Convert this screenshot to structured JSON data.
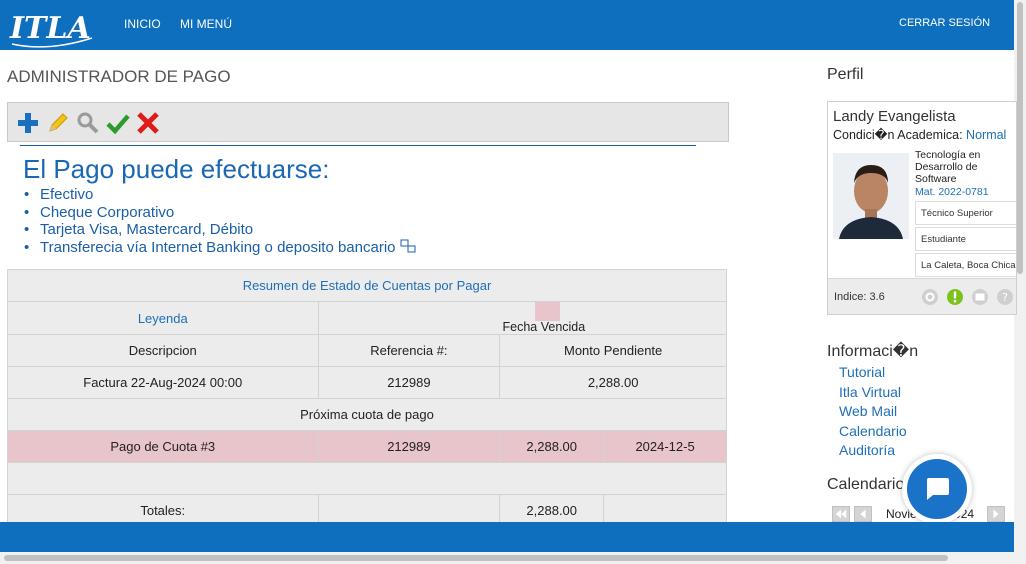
{
  "header": {
    "logo_text": "ITLA",
    "nav": [
      "INICIO",
      "MI MENÚ"
    ],
    "logout": "CERRAR SESIÓN"
  },
  "main": {
    "page_title": "ADMINISTRADOR DE PAGO",
    "toolbar_icons": [
      "add-icon",
      "edit-icon",
      "search-icon",
      "approve-icon",
      "delete-icon"
    ],
    "payment_heading": "El Pago puede efectuarse:",
    "payment_methods": [
      "Efectivo",
      "Cheque Corporativo",
      "Tarjeta Visa, Mastercard, Débito",
      "Transferecia vía Internet Banking o deposito bancario"
    ],
    "summary": {
      "caption": "Resumen de Estado de Cuentas por Pagar",
      "legend_label": "Leyenda",
      "legend_overdue": "Fecha Vencida",
      "columns": [
        "Descripcion",
        "Referencia #:",
        "Monto Pendiente"
      ],
      "invoice": {
        "description": "Factura 22-Aug-2024 00:00",
        "reference": "212989",
        "amount": "2,288.00"
      },
      "next_installment_label": "Próxima cuota de pago",
      "installment": {
        "description": "Pago de Cuota #3",
        "reference": "212989",
        "amount": "2,288.00",
        "date": "2024-12-5"
      },
      "totals_label": "Totales:",
      "totals_amount": "2,288.00"
    }
  },
  "sidebar": {
    "profile_title": "Perfil",
    "name": "Landy Evangelista",
    "condition_label": "Condici�n Academica:",
    "condition_value": "Normal",
    "career": "Tecnología en Desarrollo de Software",
    "matricula": "Mat. 2022-0781",
    "level": "Técnico Superior",
    "role": "Estudiante",
    "address": "La Caleta, Boca Chica",
    "index": "Indice: 3.6",
    "info_title": "Informaci�n",
    "info_links": [
      "Tutorial",
      "Itla Virtual",
      "Web Mail",
      "Calendario",
      "Auditoría"
    ],
    "calendar_title": "Calendario",
    "calendar_month": "Noviembre 2024"
  },
  "colors": {
    "brand_blue": "#0d6fbe",
    "link_blue": "#1e6fb8",
    "overdue_pink": "#e8c4cb"
  }
}
